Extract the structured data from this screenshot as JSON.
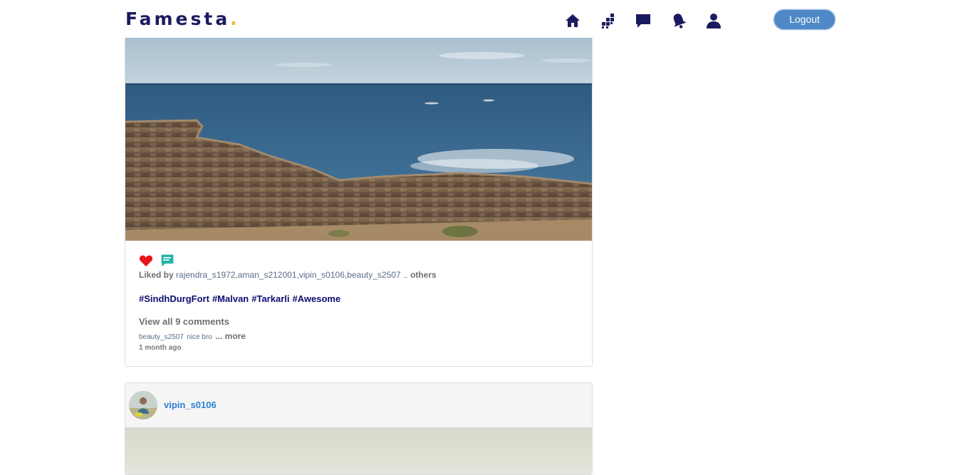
{
  "app": {
    "logo_text": "Famesta",
    "logo_dot": "."
  },
  "nav": {
    "icons": [
      "home-icon",
      "explore-icon",
      "messages-icon",
      "notifications-icon",
      "profile-icon"
    ],
    "logout_label": "Logout"
  },
  "colors": {
    "brand_navy": "#1a1b5e",
    "logo_dot": "#f2b42b",
    "logout_bg": "#4f88c6",
    "like_red": "#e8141b",
    "comment_teal": "#20b2aa",
    "hashtag": "#0b0d73",
    "username_blue": "#2a7fd6"
  },
  "post1": {
    "photo_alt": "sea-fort-wall-photo",
    "liked_by_label": "Liked by",
    "likers": "rajendra_s1972,aman_s212001,vipin_s0106,beauty_s2507",
    "likers_suffix": "..",
    "others_label": "others",
    "hashtags": [
      "#SindhDurgFort",
      "#Malvan",
      "#Tarkarli",
      "#Awesome"
    ],
    "view_all_comments": "View all 9 comments",
    "latest_comment": {
      "user": "beauty_s2507",
      "text": "nice bro",
      "more": "... more"
    },
    "time_ago": "1 month ago"
  },
  "post2": {
    "username": "vipin_s0106"
  }
}
